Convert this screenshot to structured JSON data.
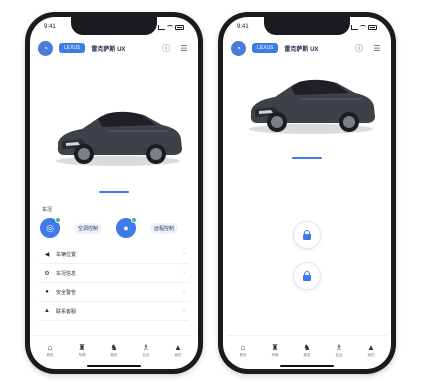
{
  "status_bar": {
    "time": "9:41"
  },
  "header": {
    "brand_label": "LEXUS",
    "car_title": "雷克萨斯 UX",
    "left_icon": "profile-icon",
    "right_icons": [
      "info-icon",
      "menu-icon"
    ]
  },
  "left_screen": {
    "section_label": "车况",
    "actions": [
      {
        "icon": "temperature-icon",
        "pill": "空调控制",
        "sub": ""
      },
      {
        "icon": "user-icon",
        "pill": "远程控制",
        "sub": ""
      }
    ],
    "menu_items": [
      {
        "icon": "location-icon",
        "label": "车辆位置"
      },
      {
        "icon": "fuel-icon",
        "label": "车况信息"
      },
      {
        "icon": "bell-icon",
        "label": "安全警告"
      },
      {
        "icon": "user-icon",
        "label": "联系客服"
      }
    ]
  },
  "right_screen": {
    "lock_buttons": [
      "unlock-button",
      "lock-button"
    ]
  },
  "tab_bar": {
    "items": [
      {
        "icon": "home-icon",
        "label": "首页"
      },
      {
        "icon": "car-icon",
        "label": "车辆"
      },
      {
        "icon": "service-icon",
        "label": "服务"
      },
      {
        "icon": "community-icon",
        "label": "社区"
      },
      {
        "icon": "profile-icon",
        "label": "我的"
      }
    ],
    "active_index": 1
  },
  "colors": {
    "accent": "#3d7be8",
    "status_green": "#38c46a",
    "frame": "#1b1b1f"
  }
}
